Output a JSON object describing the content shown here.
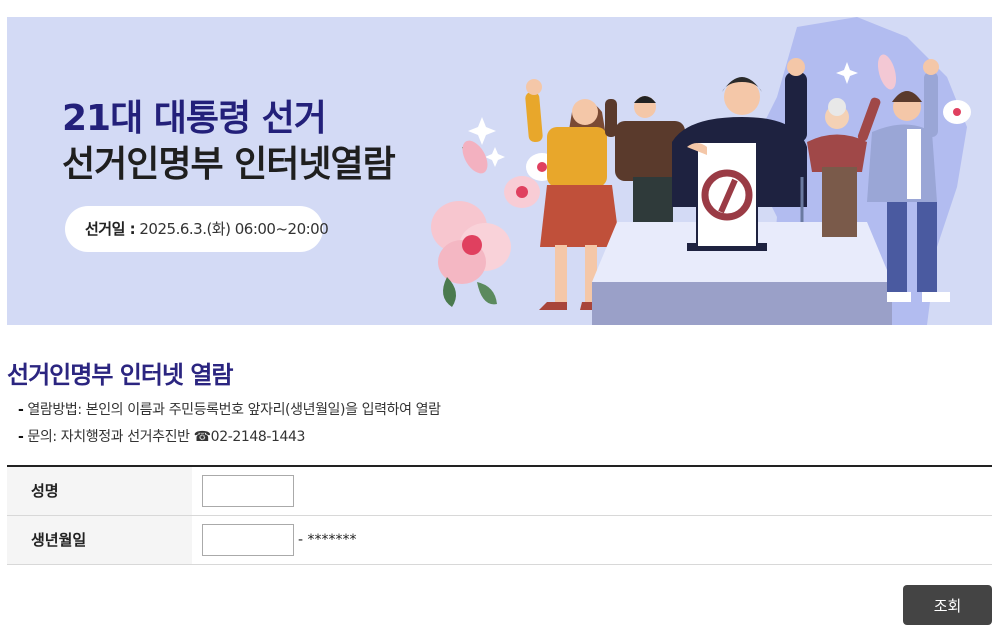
{
  "banner": {
    "title_line1": "21대 대통령 선거",
    "title_line2": "선거인명부 인터넷열람",
    "date_label": "선거일 :",
    "date_value": " 2025.6.3.(화) 06:00~20:00"
  },
  "section": {
    "title": "선거인명부 인터넷 열람",
    "info": [
      "열람방법: 본인의 이름과 주민등록번호 앞자리(생년월일)을 입력하여 열람",
      "문의: 자치행정과 선거추진반 ☎02-2148-1443"
    ],
    "info_dash": "-"
  },
  "form": {
    "name_label": "성명",
    "name_value": "",
    "birth_label": "생년월일",
    "birth_value": "",
    "birth_suffix": "- *******",
    "submit_label": "조회"
  },
  "colors": {
    "banner_bg": "#d3daf5",
    "title_accent": "#23207a",
    "button_bg": "#444444"
  },
  "icons": [
    "ballot-vote-icon",
    "phone-icon"
  ]
}
